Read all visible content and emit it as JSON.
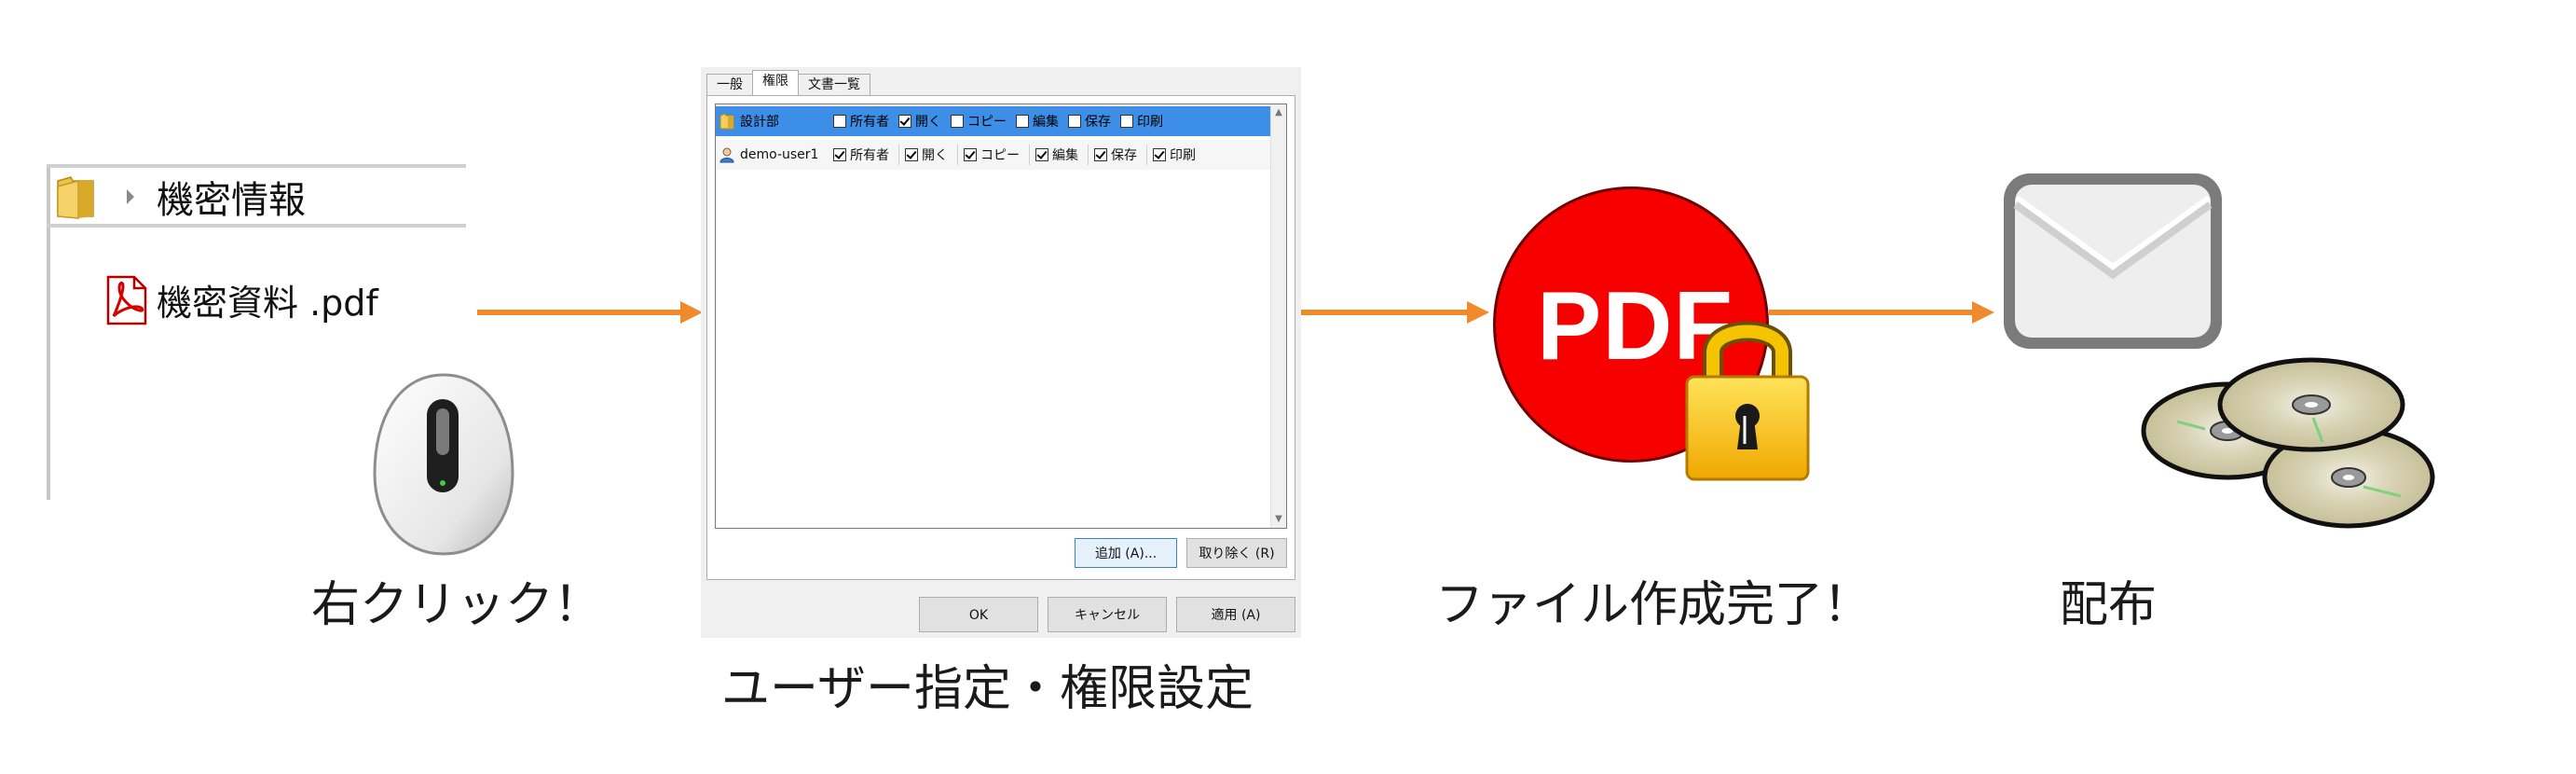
{
  "step1": {
    "folder_label": "機密情報",
    "file_label": "機密資料 .pdf",
    "caption": "右クリック！"
  },
  "step2": {
    "tabs": [
      "一般",
      "権限",
      "文書一覧"
    ],
    "active_tab": "権限",
    "rows": [
      {
        "name": "設計部",
        "icon": "folder-icon",
        "selected": true,
        "permissions": [
          {
            "label": "所有者",
            "checked": false
          },
          {
            "label": "開く",
            "checked": true
          },
          {
            "label": "コピー",
            "checked": false
          },
          {
            "label": "編集",
            "checked": false
          },
          {
            "label": "保存",
            "checked": false
          },
          {
            "label": "印刷",
            "checked": false
          }
        ]
      },
      {
        "name": "demo-user1",
        "icon": "user-icon",
        "selected": false,
        "permissions": [
          {
            "label": "所有者",
            "checked": true
          },
          {
            "label": "開く",
            "checked": true
          },
          {
            "label": "コピー",
            "checked": true
          },
          {
            "label": "編集",
            "checked": true
          },
          {
            "label": "保存",
            "checked": true
          },
          {
            "label": "印刷",
            "checked": true
          }
        ]
      }
    ],
    "add_button": "追加 (A)...",
    "remove_button": "取り除く (R)",
    "ok_button": "OK",
    "cancel_button": "キャンセル",
    "apply_button": "適用 (A)",
    "caption": "ユーザー指定・権限設定"
  },
  "step3": {
    "pdf_text": "PDF",
    "caption": "ファイル作成完了！"
  },
  "step4": {
    "caption": "配布"
  },
  "colors": {
    "arrow": "#ef8a2d",
    "pdf_red": "#f70000",
    "selection": "#3d8ee6",
    "lock_gold": "#f5c400"
  }
}
